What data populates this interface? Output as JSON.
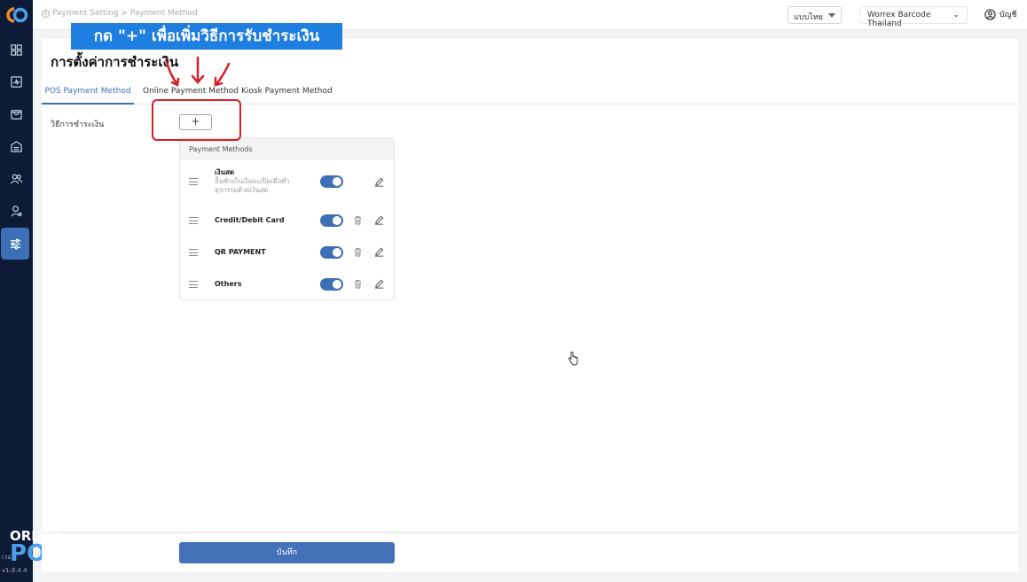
{
  "brand": {
    "order": "ORDER",
    "pos": "POS",
    "version_prefix": "เวอ",
    "version": "v1.8.4.4"
  },
  "topbar": {
    "breadcrumb": "Payment Setting > Payment Method",
    "language": "แบบไทย",
    "store": "Worrex Barcode Thailand",
    "account": "บัญชี"
  },
  "page": {
    "title": "การตั้งค่าการชำระเงิน",
    "tabs": [
      {
        "label": "POS Payment Method"
      },
      {
        "label": "Online Payment Method"
      },
      {
        "label": "Kiosk Payment Method"
      }
    ],
    "field_label": "วิธีการชำระเงิน",
    "add_label": "+",
    "methods_header": "Payment Methods",
    "methods": [
      {
        "name": "เงินสด",
        "desc": "ลิ้นชักเก็บเงินจะเปิดเมื่อทำธุรกรรมด้วยเงินสด",
        "enabled": true
      },
      {
        "name": "Credit/Debit Card",
        "desc": "",
        "enabled": true
      },
      {
        "name": "QR PAYMENT",
        "desc": "",
        "enabled": true
      },
      {
        "name": "Others",
        "desc": "",
        "enabled": true
      }
    ],
    "save_label": "บันทึก"
  },
  "overlay": {
    "banner": "กด \"+\" เพื่อเพิ่มวิธีการรับชำระเงิน",
    "highlight_color": "#d61f26",
    "banner_color": "#1e7fe0"
  },
  "colors": {
    "sidebar": "#0d1b36",
    "accent": "#3d6fb6",
    "save": "#4472b8"
  },
  "icons": [
    "dashboard-icon",
    "pos-icon",
    "bag-icon",
    "inventory-icon",
    "customers-icon",
    "staff-icon",
    "settings-sliders-icon"
  ]
}
